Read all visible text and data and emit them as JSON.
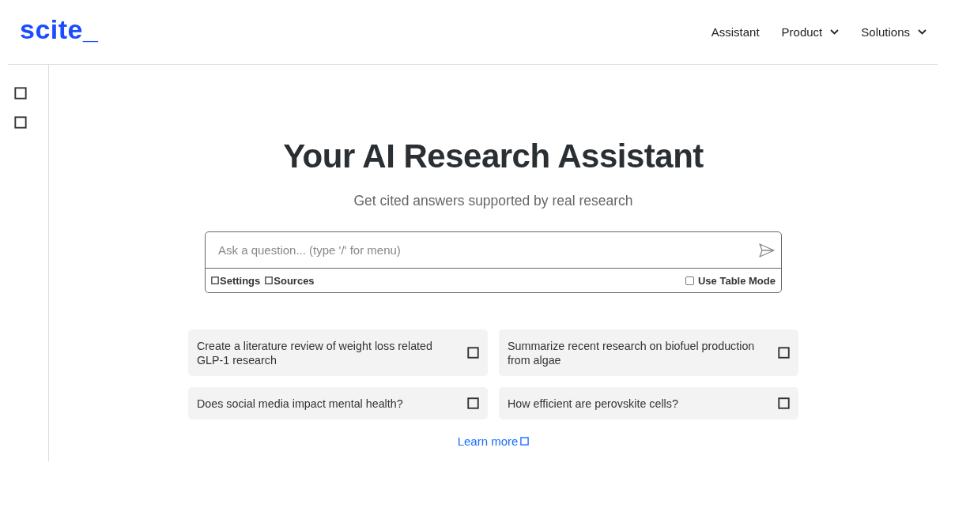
{
  "header": {
    "logo": "scite_",
    "nav": [
      {
        "label": "Assistant",
        "dropdown": false
      },
      {
        "label": "Product",
        "dropdown": true
      },
      {
        "label": "Solutions",
        "dropdown": true
      }
    ]
  },
  "sidebar": {
    "items": [
      {
        "kind": "icon"
      },
      {
        "kind": "icon"
      }
    ]
  },
  "hero": {
    "title": "Your AI Research Assistant",
    "subtitle": "Get cited answers supported by real research"
  },
  "ask": {
    "placeholder": "Ask a question... (type '/' for menu)",
    "options": [
      {
        "label": "Settings"
      },
      {
        "label": "Sources"
      }
    ],
    "table_mode": {
      "label": "Use Table Mode",
      "checked": false
    }
  },
  "prompts": [
    {
      "text": "Create a literature review of weight loss related GLP-1 research"
    },
    {
      "text": "Summarize recent research on biofuel production from algae"
    },
    {
      "text": "Does social media impact mental health?"
    },
    {
      "text": "How efficient are perovskite cells?"
    }
  ],
  "learn_more": "Learn more"
}
